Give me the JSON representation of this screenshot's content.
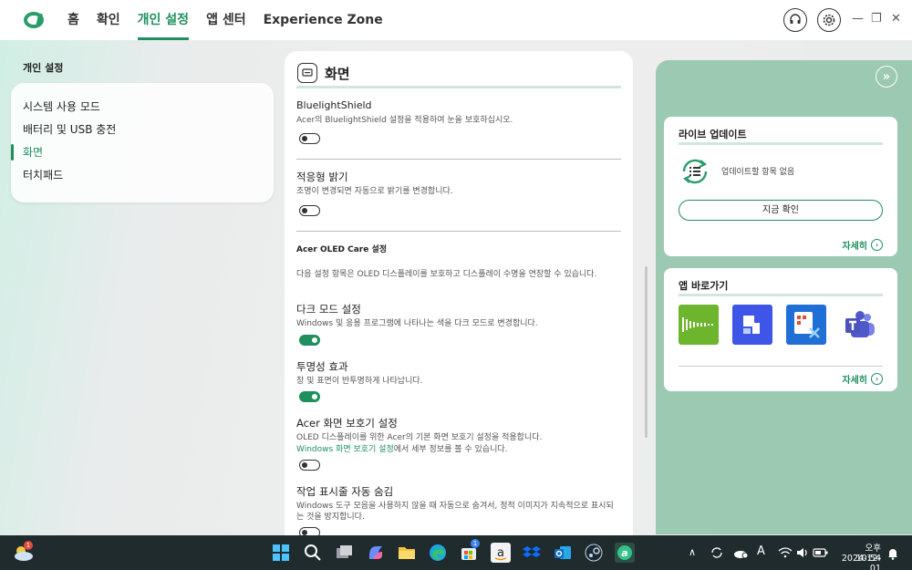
{
  "header": {
    "nav": [
      "홈",
      "확인",
      "개인 설정",
      "앱 센터",
      "Experience Zone"
    ],
    "active_nav": 2
  },
  "sidebar": {
    "title": "개인 설정",
    "items": [
      {
        "label": "시스템 사용 모드"
      },
      {
        "label": "배터리 및 USB 충전"
      },
      {
        "label": "화면"
      },
      {
        "label": "터치패드"
      }
    ],
    "active_index": 2
  },
  "main": {
    "section_title": "화면",
    "settings": [
      {
        "title": "BluelightShield",
        "desc": "Acer의 BluelightShield 설정을 적용하여 눈을 보호하십시오.",
        "state": "off"
      },
      {
        "title": "적응형 밝기",
        "desc": "조명이 변경되면 자동으로 밝기를 변경합니다.",
        "state": "off"
      },
      {
        "title": "Acer OLED Care 설정",
        "desc": "다음 설정 항목은 OLED 디스플레이를 보호하고 디스플레이 수명을 연장할 수 있습니다."
      },
      {
        "title": "다크 모드 설정",
        "desc": "Windows 및 응용 프로그램에 나타나는 색을 다크 모드로 변경합니다.",
        "state": "on"
      },
      {
        "title": "투명성 효과",
        "desc": "창 및 표면이 반투명하게 나타납니다.",
        "state": "on"
      },
      {
        "title": "Acer 화면 보호기 설정",
        "desc": "OLED 디스플레이를 위한 Acer의 기본 화면 보호기 설정을 적용합니다.",
        "link": "Windows 화면 보호기 설정",
        "desc_suffix": "에서 세부 정보를 볼 수 있습니다.",
        "state": "off"
      },
      {
        "title": "작업 표시줄 자동 숨김",
        "desc": "Windows 도구 모음을 사용하지 않을 때 자동으로 숨겨서, 정적 이미지가 지속적으로 표시되는 것을 방지합니다.",
        "state": "off"
      }
    ]
  },
  "right": {
    "live_update": {
      "title": "라이브 업데이트",
      "status": "업데이트할 항목 없음",
      "button": "지금 확인",
      "more": "자세히"
    },
    "app_shortcuts": {
      "title": "앱 바로가기",
      "more": "자세히",
      "apps": [
        "acer-audio-app",
        "dashlane-app",
        "snipping-tool-app",
        "teams-app"
      ]
    }
  },
  "taskbar": {
    "weather_badge": "1",
    "store_badge": "1",
    "time": "오후 10:54",
    "date": "2024-12-01",
    "ime": "A",
    "accent": "#1f8f5f"
  }
}
